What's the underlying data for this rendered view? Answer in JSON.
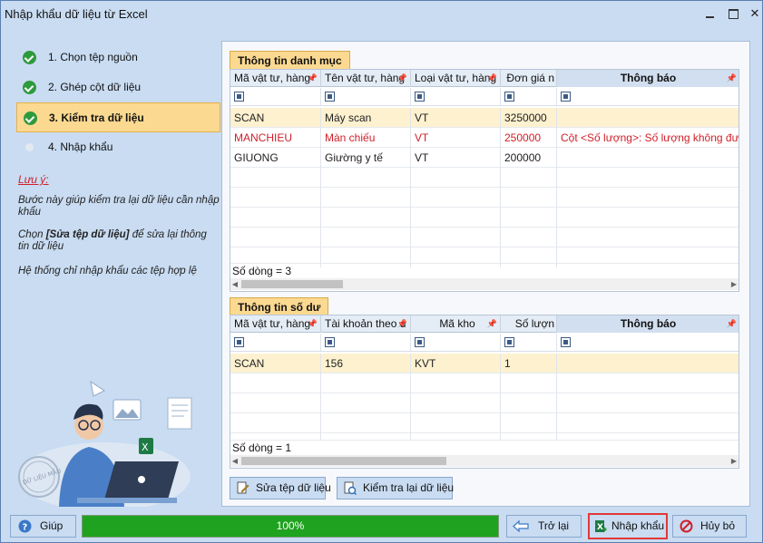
{
  "window": {
    "title": "Nhập khẩu dữ liệu từ Excel"
  },
  "steps": [
    {
      "label": "1. Chọn tệp nguồn",
      "state": "done"
    },
    {
      "label": "2. Ghép cột dữ liệu",
      "state": "done"
    },
    {
      "label": "3. Kiểm tra dữ liệu",
      "state": "active"
    },
    {
      "label": "4. Nhập khẩu",
      "state": "pending"
    }
  ],
  "notes": {
    "title": "Lưu ý:",
    "line1": "Bước này giúp kiểm tra lại dữ liệu cần nhập khẩu",
    "line2_prefix": "Chọn ",
    "line2_bold": "[Sửa tệp dữ liệu]",
    "line2_suffix": " để sửa lại thông tin dữ liệu",
    "line3": "Hệ thống chỉ nhập khẩu các tệp hợp lệ"
  },
  "illustration": {
    "stamp_text": "DỮ LIỆU MẪU"
  },
  "catalog": {
    "tab": "Thông tin danh mục",
    "columns": [
      "Mã vật tư, hàng",
      "Tên vật tư, hàng",
      "Loại vật tư, hàng",
      "Đơn giá n",
      "Thông báo"
    ],
    "rows": [
      {
        "code": "SCAN",
        "name": "Máy scan",
        "type": "VT",
        "price": "3250000",
        "notice": ""
      },
      {
        "code": "MANCHIEU",
        "name": "Màn chiếu",
        "type": "VT",
        "price": "250000",
        "notice": "Cột <Số lượng>: Số lượng không được"
      },
      {
        "code": "GIUONG",
        "name": "Giường y tế",
        "type": "VT",
        "price": "200000",
        "notice": ""
      }
    ],
    "footer": "Số dòng = 3"
  },
  "balance": {
    "tab": "Thông tin số dư",
    "columns": [
      "Mã vật tư, hàng",
      "Tài khoản theo d",
      "Mã kho",
      "Số lượn",
      "Thông báo"
    ],
    "rows": [
      {
        "code": "SCAN",
        "account": "156",
        "warehouse": "KVT",
        "qty": "1",
        "notice": ""
      }
    ],
    "footer": "Số dòng = 1"
  },
  "actions": {
    "edit_file": "Sửa tệp dữ liệu",
    "recheck": "Kiểm tra lại dữ liệu"
  },
  "bottom": {
    "help": "Giúp",
    "progress_text": "100%",
    "progress_value": 1.0,
    "back": "Trở lại",
    "import": "Nhập khẩu",
    "cancel": "Hủy bỏ"
  },
  "colors": {
    "window_bg": "#c9dcf2",
    "active_step": "#fbd990",
    "error_text": "#d0202a",
    "progress": "#1fa21f",
    "highlight_border": "#e23838"
  }
}
